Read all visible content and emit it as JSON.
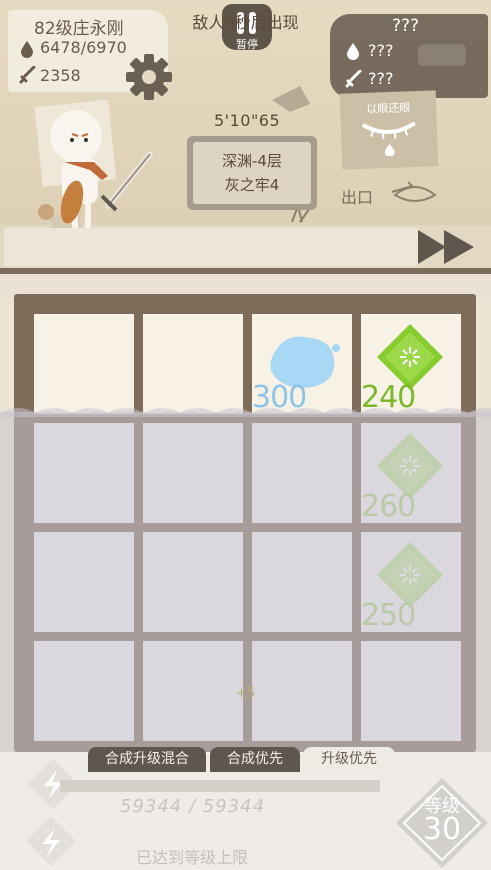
{
  "player": {
    "name": "82级庄永刚",
    "hp": "6478/6970",
    "attack": "2358"
  },
  "pause": {
    "label": "暂停"
  },
  "enemy": {
    "name": "???",
    "hp": "???",
    "attack": "???"
  },
  "battle": {
    "timer": "5'10\"65",
    "floor_line1": "深渊-4层",
    "floor_line2": "灰之牢4",
    "skill_label": "以眼还眼",
    "exit_label": "出口",
    "banner": "敌人9秒后出现"
  },
  "board": {
    "cells": [
      {
        "row": 0,
        "col": 2,
        "kind": "water-drop",
        "value": "300"
      },
      {
        "row": 0,
        "col": 3,
        "kind": "green-gem",
        "value": "240"
      },
      {
        "row": 1,
        "col": 3,
        "kind": "green-gem",
        "value": "260"
      },
      {
        "row": 2,
        "col": 3,
        "kind": "green-gem",
        "value": "250"
      }
    ],
    "floating_text": "+5"
  },
  "modes": {
    "mix": "合成升级混合",
    "merge": "合成优先",
    "upgrade": "升级优先",
    "active": "upgrade"
  },
  "progress": {
    "xp_text": "59344 / 59344",
    "xp_fraction": 1.0,
    "max_text": "已达到等级上限",
    "level_label": "等级",
    "level": "30"
  },
  "colors": {
    "green_gem": "#86cc2f",
    "water": "#a9d8f5",
    "frame": "#7e6c5b"
  }
}
